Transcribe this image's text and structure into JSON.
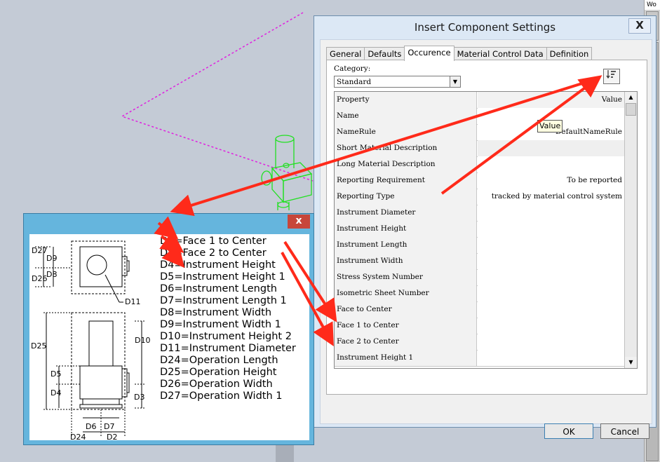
{
  "background": {
    "color": "#c4cbd6",
    "workspace_strip_label": "Wo"
  },
  "dialog": {
    "title": "Insert Component Settings",
    "close_label": "X",
    "tabs": [
      {
        "label": "General",
        "active": false
      },
      {
        "label": "Defaults",
        "active": false
      },
      {
        "label": "Occurence",
        "active": true
      },
      {
        "label": "Material Control Data",
        "active": false
      },
      {
        "label": "Definition",
        "active": false
      }
    ],
    "category_label": "Category:",
    "category_value": "Standard",
    "sort_icon": "sort-properties-icon",
    "grid_header": {
      "property": "Property",
      "value": "Value"
    },
    "rows": [
      {
        "property": "Name",
        "value": ""
      },
      {
        "property": "NameRule",
        "value": "DefaultNameRule"
      },
      {
        "property": "Short Material Description",
        "value": ""
      },
      {
        "property": "Long Material Description",
        "value": ""
      },
      {
        "property": "Reporting Requirement",
        "value": "To be reported"
      },
      {
        "property": "Reporting Type",
        "value": "tracked by material control system"
      },
      {
        "property": "Instrument Diameter",
        "value": ""
      },
      {
        "property": "Instrument Height",
        "value": ""
      },
      {
        "property": "Instrument Length",
        "value": ""
      },
      {
        "property": "Instrument Width",
        "value": ""
      },
      {
        "property": "Stress System Number",
        "value": ""
      },
      {
        "property": "Isometric Sheet Number",
        "value": ""
      },
      {
        "property": "Face to Center",
        "value": ""
      },
      {
        "property": "Face 1 to Center",
        "value": ""
      },
      {
        "property": "Face 2 to Center",
        "value": ""
      },
      {
        "property": "Instrument Height 1",
        "value": ""
      }
    ],
    "tooltip": "Value",
    "ok_label": "OK",
    "cancel_label": "Cancel"
  },
  "popup": {
    "close_label": "x",
    "legend": [
      "D2=Face 1 to Center",
      "D3=Face 2 to Center",
      "D4=Instrument Height",
      "D5=Instrument Height 1",
      "D6=Instrument Length",
      "D7=Instrument Length 1",
      "D8=Instrument Width",
      "D9=Instrument Width 1",
      "D10=Instrument Height 2",
      "D11=Instrument Diameter",
      "D24=Operation Length",
      "D25=Operation Height",
      "D26=Operation Width",
      "D27=Operation Width 1"
    ],
    "dims": {
      "d27": "D27",
      "d9": "D9",
      "d26": "D26",
      "d8": "D8",
      "d11": "D11",
      "d25": "D25",
      "d10": "D10",
      "d5": "D5",
      "d4": "D4",
      "d3": "D3",
      "d6": "D6",
      "d7": "D7",
      "d24": "D24",
      "d2": "D2"
    }
  },
  "colors": {
    "annotation_arrow": "#ff2a1a",
    "dashed_line": "#e020e0",
    "model_green": "#22e022",
    "popup_frame": "#65b5dd"
  }
}
